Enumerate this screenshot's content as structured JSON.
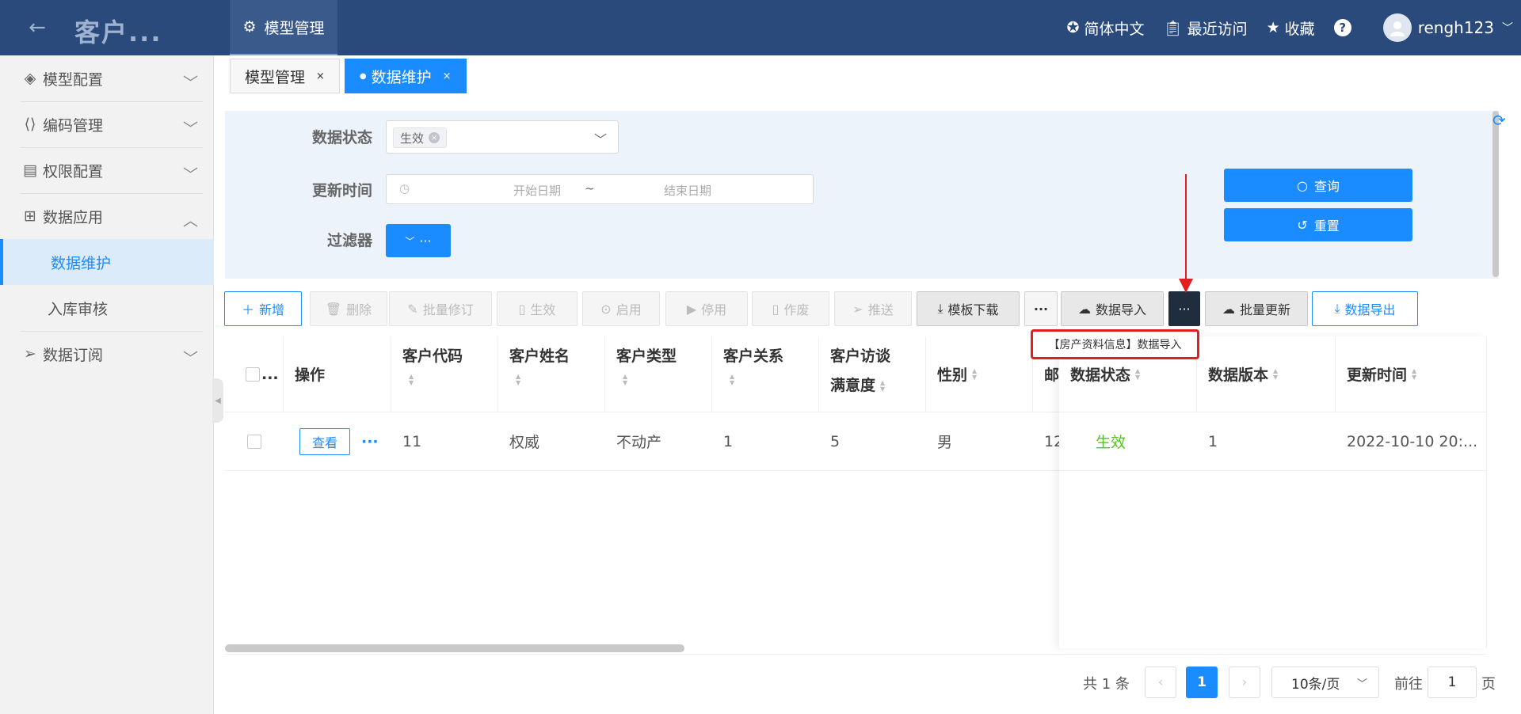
{
  "topbar": {
    "back_icon": "arrow-left-icon",
    "app_title": "客户...",
    "tab_label": "模型管理",
    "language": "简体中文",
    "recent": "最近访问",
    "favorites": "收藏",
    "help": "?",
    "username": "rengh123"
  },
  "sidebar": {
    "items": [
      {
        "label": "模型配置",
        "icon": "cube-icon"
      },
      {
        "label": "编码管理",
        "icon": "code-icon"
      },
      {
        "label": "权限配置",
        "icon": "lock-file-icon"
      },
      {
        "label": "数据应用",
        "icon": "grid-icon"
      },
      {
        "label": "数据维护"
      },
      {
        "label": "入库审核"
      },
      {
        "label": "数据订阅",
        "icon": "send-icon"
      }
    ]
  },
  "tabs": [
    {
      "label": "模型管理",
      "close": "×"
    },
    {
      "label": "数据维护",
      "close": "×",
      "dot": "●"
    }
  ],
  "filter": {
    "status_label": "数据状态",
    "status_chip": "生效",
    "time_label": "更新时间",
    "start_placeholder": "开始日期",
    "range_sep": "~",
    "end_placeholder": "结束日期",
    "filter_label": "过滤器",
    "query_button": "查询",
    "reset_button": "重置"
  },
  "toolbar": {
    "add": "新增",
    "delete": "删除",
    "batch_edit": "批量修订",
    "activate": "生效",
    "enable": "启用",
    "disable": "停用",
    "void": "作废",
    "push": "推送",
    "template_download": "模板下载",
    "more": "···",
    "data_import": "数据导入",
    "batch_update": "批量更新",
    "data_export": "数据导出"
  },
  "tooltip": "【房产资料信息】数据导入",
  "table": {
    "headers": {
      "select": "...",
      "operation": "操作",
      "customer_code": "客户代码",
      "customer_name": "客户姓名",
      "customer_type": "客户类型",
      "customer_relation": "客户关系",
      "satisfaction_1": "客户访谈",
      "satisfaction_2": "满意度",
      "gender": "性别",
      "email_partial": "邮",
      "data_status": "数据状态",
      "data_version": "数据版本",
      "update_time": "更新时间"
    },
    "rows": [
      {
        "view": "查看",
        "more": "···",
        "customer_code": "11",
        "customer_name": "权威",
        "customer_type": "不动产",
        "customer_relation": "1",
        "satisfaction": "5",
        "gender": "男",
        "email_partial": "12",
        "data_status": "生效",
        "data_version": "1",
        "update_time": "2022-10-10 20:..."
      }
    ]
  },
  "pagination": {
    "total": "共 1 条",
    "current_page": "1",
    "page_size": "10条/页",
    "goto_label": "前往",
    "goto_value": "1",
    "page_suffix": "页"
  },
  "colors": {
    "topbar": "#2a4a7b",
    "primary": "#1a8cff",
    "success": "#52c41a",
    "annotation": "#e02020"
  }
}
